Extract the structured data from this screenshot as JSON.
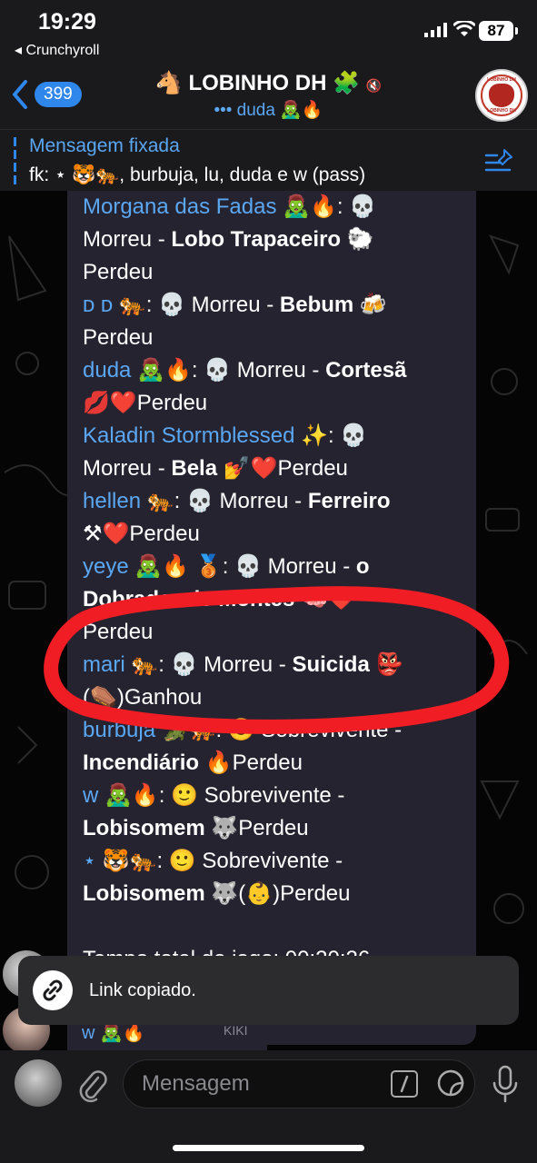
{
  "status_bar": {
    "time": "19:29",
    "back_app": "◂ Crunchyroll",
    "battery": "87"
  },
  "header": {
    "back_count": "399",
    "title": "🐴 LOBINHO DH 🧩",
    "mute_glyph": "🔇",
    "subtitle": "••• duda 🧟‍♂️🔥",
    "avatar_text_top": "LOBINHO DH",
    "avatar_text_bottom": "LOBINHO DH"
  },
  "pinned": {
    "title": "Mensagem fixada",
    "text": "fk: ⋆ 🐯🐅, burbuja, lu, duda e w (pass)"
  },
  "message": {
    "lines": [
      [
        {
          "t": "Morgana das Fadas 🧟‍♂️🔥",
          "c": "name"
        },
        {
          "t": ": 💀"
        }
      ],
      [
        {
          "t": "Morreu - "
        },
        {
          "t": "Lobo Trapaceiro",
          "c": "b"
        },
        {
          "t": " 🐑"
        }
      ],
      [
        {
          "t": "Perdeu"
        }
      ],
      [
        {
          "t": " ᴅ ᴅ 🐅",
          "c": "name"
        },
        {
          "t": ": 💀 Morreu - "
        },
        {
          "t": "Bebum",
          "c": "b"
        },
        {
          "t": " 🍻"
        }
      ],
      [
        {
          "t": "Perdeu"
        }
      ],
      [
        {
          "t": "duda 🧟‍♂️🔥",
          "c": "name"
        },
        {
          "t": ": 💀 Morreu - "
        },
        {
          "t": "Cortesã",
          "c": "b"
        }
      ],
      [
        {
          "t": "💋❤️Perdeu"
        }
      ],
      [
        {
          "t": "Kaladin Stormblessed ✨",
          "c": "name"
        },
        {
          "t": ": 💀"
        }
      ],
      [
        {
          "t": "Morreu - "
        },
        {
          "t": "Bela",
          "c": "b"
        },
        {
          "t": " 💅❤️Perdeu"
        }
      ],
      [
        {
          "t": "hellen 🐅",
          "c": "name"
        },
        {
          "t": ": 💀 Morreu - "
        },
        {
          "t": "Ferreiro",
          "c": "b"
        }
      ],
      [
        {
          "t": "⚒❤️Perdeu"
        }
      ],
      [
        {
          "t": "yeye 🧟‍♂️🔥 🥉",
          "c": "name"
        },
        {
          "t": ": 💀 Morreu - "
        },
        {
          "t": "o",
          "c": "b"
        }
      ],
      [
        {
          "t": "Dobrador de Montes",
          "c": "b"
        },
        {
          "t": " 🧠❤️"
        }
      ],
      [
        {
          "t": "Perdeu"
        }
      ],
      [
        {
          "t": "mari 🐅",
          "c": "name"
        },
        {
          "t": ": 💀 Morreu - "
        },
        {
          "t": "Suicida",
          "c": "b"
        },
        {
          "t": " 👺"
        }
      ],
      [
        {
          "t": "(⚰️)Ganhou"
        }
      ],
      [
        {
          "t": "burbuja 🐊",
          "c": "name"
        },
        {
          "t": "🐅: 🙂 Sobrevivente -"
        }
      ],
      [
        {
          "t": "Incendiário",
          "c": "b"
        },
        {
          "t": " 🔥Perdeu"
        }
      ],
      [
        {
          "t": "w 🧟‍♂️🔥",
          "c": "name"
        },
        {
          "t": ": 🙂 Sobrevivente -"
        }
      ],
      [
        {
          "t": "Lobisomem",
          "c": "b"
        },
        {
          "t": " 🐺Perdeu"
        }
      ],
      [
        {
          "t": "⋆ 🐯🐅",
          "c": "name"
        },
        {
          "t": ": 🙂 Sobrevivente -"
        }
      ],
      [
        {
          "t": "Lobisomem",
          "c": "b"
        },
        {
          "t": " 🐺(👶)Perdeu"
        }
      ],
      [
        {
          "t": " "
        }
      ],
      [
        {
          "t": "Tempo total do jogo: 00:20:26"
        }
      ]
    ]
  },
  "toast": {
    "text": "Link copiado."
  },
  "next_message": {
    "name": "w 🧟‍♂️🔥",
    "tag": "KIKI"
  },
  "input": {
    "placeholder": "Mensagem"
  },
  "colors": {
    "accent": "#2f86eb",
    "name": "#5aa7f3",
    "bubble": "#262330",
    "scribble": "#f01d24"
  }
}
